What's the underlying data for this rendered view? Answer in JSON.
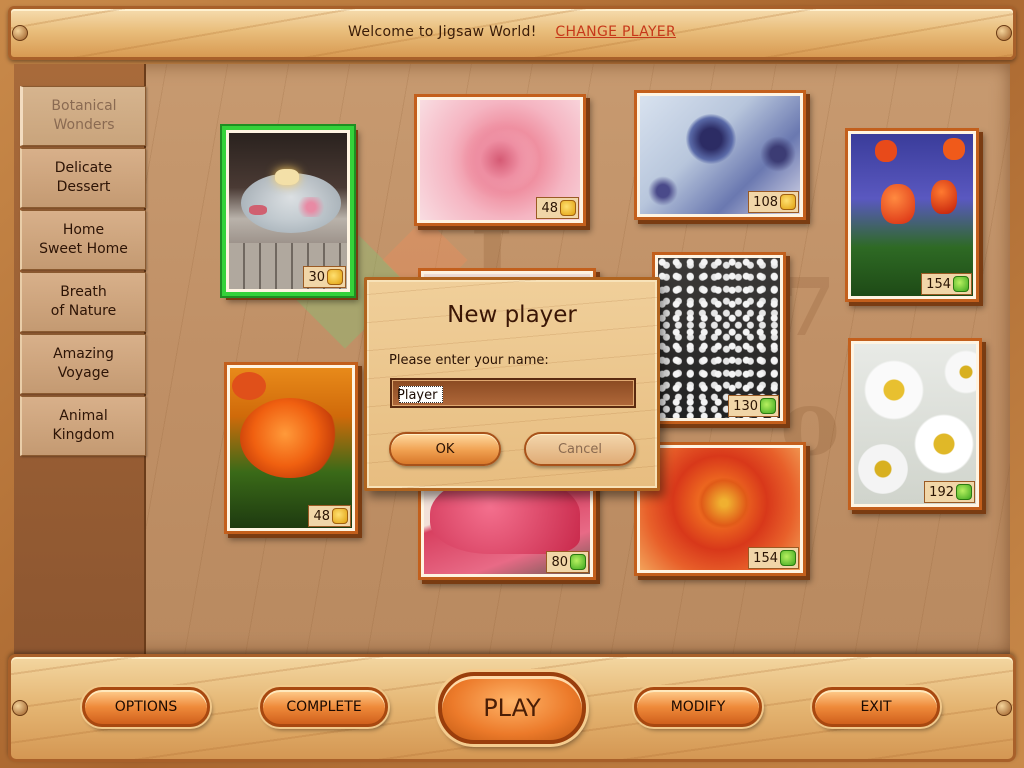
{
  "header": {
    "welcome": "Welcome to Jigsaw World!",
    "change_player": "CHANGE PLAYER"
  },
  "sidebar": {
    "items": [
      {
        "line1": "Botanical",
        "line2": "Wonders",
        "active": true
      },
      {
        "line1": "Delicate",
        "line2": "Dessert"
      },
      {
        "line1": "Home",
        "line2": "Sweet Home"
      },
      {
        "line1": "Breath",
        "line2": "of Nature"
      },
      {
        "line1": "Amazing",
        "line2": "Voyage"
      },
      {
        "line1": "Animal",
        "line2": "Kingdom"
      }
    ]
  },
  "puzzles": [
    {
      "pieces": "30",
      "subject": "candles-in-bowl",
      "selected": true
    },
    {
      "pieces": "48",
      "subject": "pink-rose"
    },
    {
      "pieces": "108",
      "subject": "blue-thistle"
    },
    {
      "pieces": "154",
      "subject": "tulips"
    },
    {
      "pieces": "48",
      "subject": "orange-rose"
    },
    {
      "pieces": "130",
      "subject": "baby-breath"
    },
    {
      "pieces": "192",
      "subject": "daisies"
    },
    {
      "pieces": "80",
      "subject": "petal-drops"
    },
    {
      "pieces": "154",
      "subject": "red-dahlia"
    }
  ],
  "dialog": {
    "title": "New player",
    "prompt": "Please enter your name:",
    "input_value": "Player",
    "ok_label": "OK",
    "cancel_label": "Cancel"
  },
  "toolbar": {
    "options": "OPTIONS",
    "complete": "COMPLETE",
    "play": "PLAY",
    "modify": "MODIFY",
    "exit": "EXIT"
  },
  "colors": {
    "accent_link": "#c6381a",
    "selected_tile": "#35d23a",
    "tile_border": "#c35f1c"
  }
}
